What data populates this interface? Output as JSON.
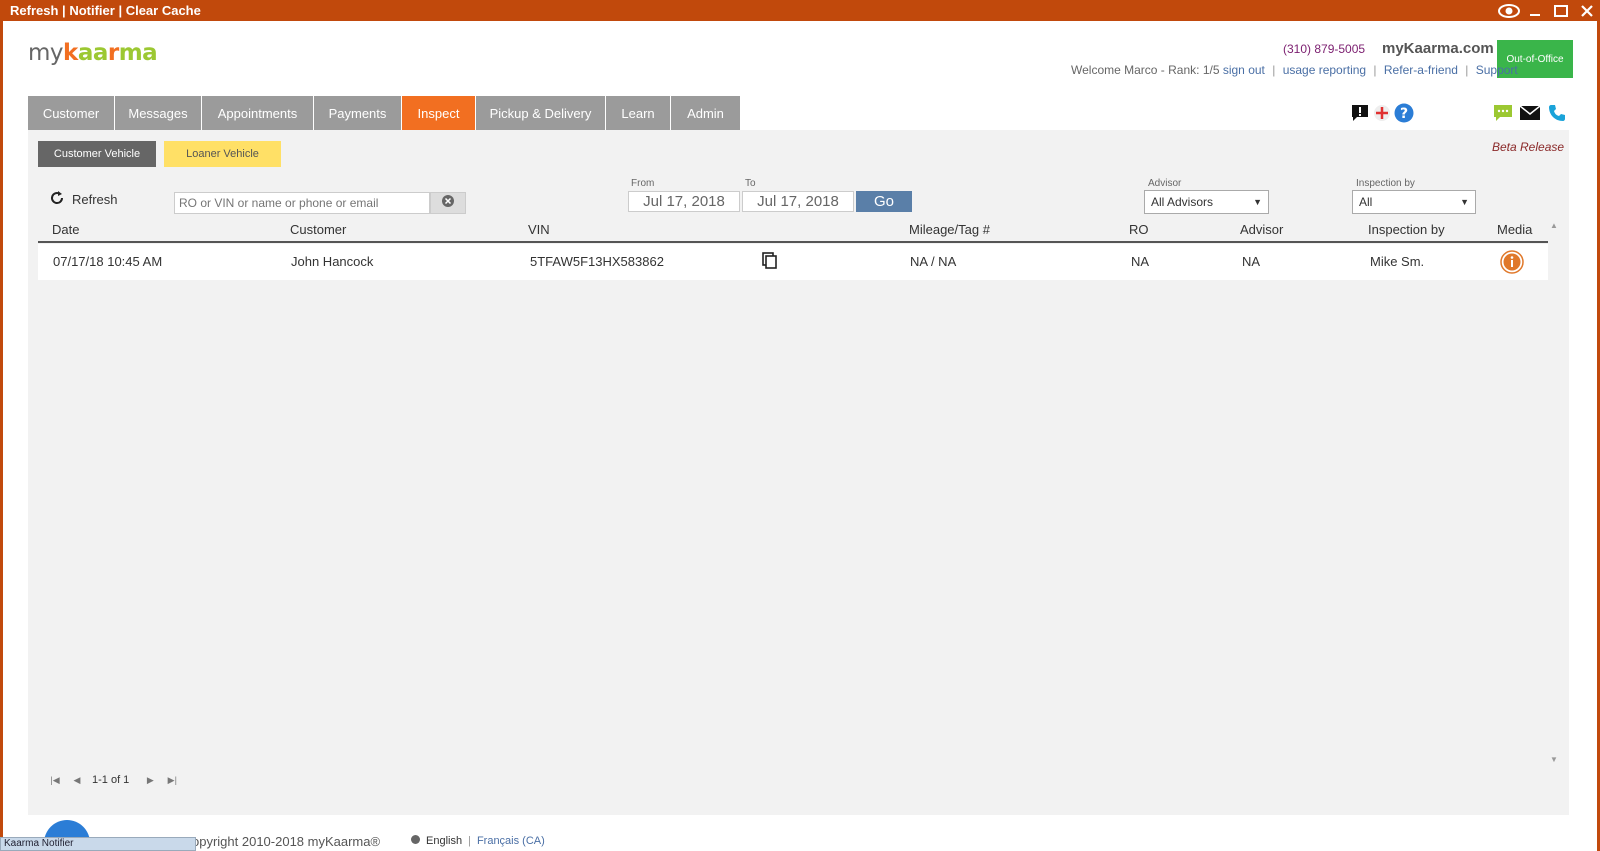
{
  "titlebar": {
    "links": [
      "Refresh",
      "Notifier",
      "Clear Cache"
    ],
    "separator": "|",
    "icons": [
      "eye-icon",
      "minimize-icon",
      "maximize-icon",
      "close-icon"
    ]
  },
  "header": {
    "logo": {
      "my": "my",
      "k": "k",
      "aa": "aa",
      "r": "r",
      "ma": "ma"
    },
    "phone": "(310) 879-5005",
    "site": "myKaarma.com",
    "out_of_office": "Out-of-Office",
    "welcome": "Welcome Marco -  Rank: ",
    "rank": "1/5",
    "links": [
      "sign out",
      "usage reporting",
      "Refer-a-friend",
      "Support"
    ],
    "sep": "|"
  },
  "nav": {
    "tabs": [
      "Customer",
      "Messages",
      "Appointments",
      "Payments",
      "Inspect",
      "Pickup & Delivery",
      "Learn",
      "Admin"
    ],
    "active": "Inspect"
  },
  "toolbar": {
    "customer_vehicle": "Customer Vehicle",
    "loaner_vehicle": "Loaner Vehicle",
    "beta": "Beta Release",
    "refresh": "Refresh",
    "search_placeholder": "RO or VIN or name or phone or email",
    "from_label": "From",
    "to_label": "To",
    "from_date": "Jul 17, 2018",
    "to_date": "Jul 17, 2018",
    "go": "Go",
    "advisor_label": "Advisor",
    "advisor_value": "All Advisors",
    "inspection_label": "Inspection by",
    "inspection_value": "All"
  },
  "table": {
    "headers": [
      "Date",
      "Customer",
      "VIN",
      "Mileage/Tag #",
      "RO",
      "Advisor",
      "Inspection by",
      "Media"
    ],
    "rows": [
      {
        "date": "07/17/18 10:45 AM",
        "customer": "John Hancock",
        "vin": "5TFAW5F13HX583862",
        "mileage": "NA / NA",
        "ro": "NA",
        "advisor": "NA",
        "inspection_by": "Mike Sm."
      }
    ]
  },
  "pager": {
    "text": "1-1 of 1"
  },
  "footer": {
    "copyright": "opyright 2010-2018 myKaarma®",
    "lang_current": "English",
    "lang_sep": "|",
    "lang_other": "Français (CA)",
    "notifier": "Kaarma Notifier"
  },
  "colors": {
    "brand_orange": "#c1490c",
    "tab_active": "#f26f21",
    "tab": "#9b9b9b",
    "ooo_green": "#3ab54a",
    "go_blue": "#5a7fa8"
  }
}
